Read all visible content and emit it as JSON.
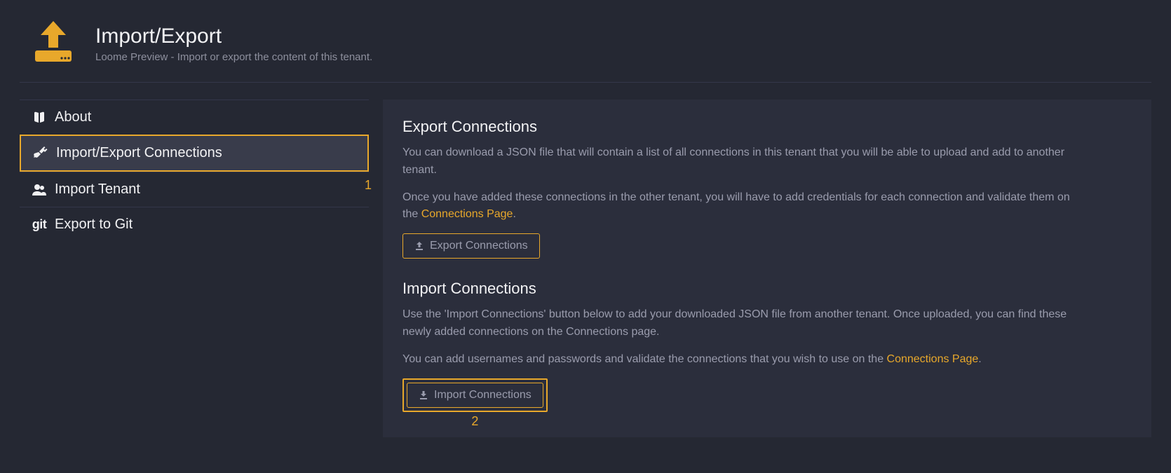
{
  "header": {
    "title": "Import/Export",
    "subtitle": "Loome Preview - Import or export the content of this tenant."
  },
  "sidebar": {
    "items": [
      {
        "label": "About"
      },
      {
        "label": "Import/Export Connections"
      },
      {
        "label": "Import Tenant"
      },
      {
        "label": "Export to Git",
        "icon_text": "git"
      }
    ]
  },
  "annotations": {
    "one": "1",
    "two": "2"
  },
  "export_section": {
    "title": "Export Connections",
    "p1": "You can download a JSON file that will contain a list of all connections in this tenant that you will be able to upload and add to another tenant.",
    "p2_before_link": "Once you have added these connections in the other tenant, you will have to add credentials for each connection and validate them on the ",
    "p2_link": "Connections Page",
    "p2_after_link": ".",
    "button": "Export Connections"
  },
  "import_section": {
    "title": "Import Connections",
    "p1": "Use the 'Import Connections' button below to add your downloaded JSON file from another tenant. Once uploaded, you can find these newly added connections on the Connections page.",
    "p2_before_link": "You can add usernames and passwords and validate the connections that you wish to use on the ",
    "p2_link": "Connections Page",
    "p2_after_link": ".",
    "button": "Import Connections"
  }
}
